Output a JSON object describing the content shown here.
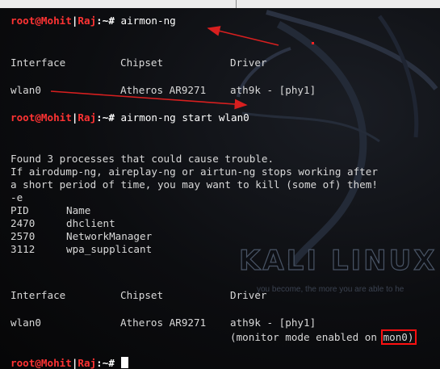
{
  "prompt": {
    "user": "root@Mohit",
    "sep": "|",
    "host": "Raj",
    "path": ":~#"
  },
  "commands": [
    "airmon-ng",
    "airmon-ng start wlan0"
  ],
  "table1": {
    "headers": [
      "Interface",
      "Chipset",
      "Driver"
    ],
    "row": [
      "wlan0",
      "Atheros AR9271",
      "ath9k - [phy1]"
    ]
  },
  "warning": [
    "Found 3 processes that could cause trouble.",
    "If airodump-ng, aireplay-ng or airtun-ng stops working after",
    "a short period of time, you may want to kill (some of) them!",
    "-e"
  ],
  "processes": {
    "headers": [
      "PID",
      "Name"
    ],
    "rows": [
      [
        "2470",
        "dhclient"
      ],
      [
        "2570",
        "NetworkManager"
      ],
      [
        "3112",
        "wpa_supplicant"
      ]
    ]
  },
  "table2": {
    "headers": [
      "Interface",
      "Chipset",
      "Driver"
    ],
    "row": [
      "wlan0",
      "Atheros AR9271",
      "ath9k - [phy1]"
    ],
    "monitor_text": "(monitor mode enabled on ",
    "monitor_iface": "mon0",
    "monitor_close": ")"
  },
  "watermark": {
    "title": "KALI LINUX",
    "tagline": "you become, the more you are able to he"
  },
  "colors": {
    "prompt_user": "#ff3333",
    "prompt_path": "#6ea0ff",
    "highlight_box": "#ff1010",
    "arrow": "#d81f1f"
  }
}
